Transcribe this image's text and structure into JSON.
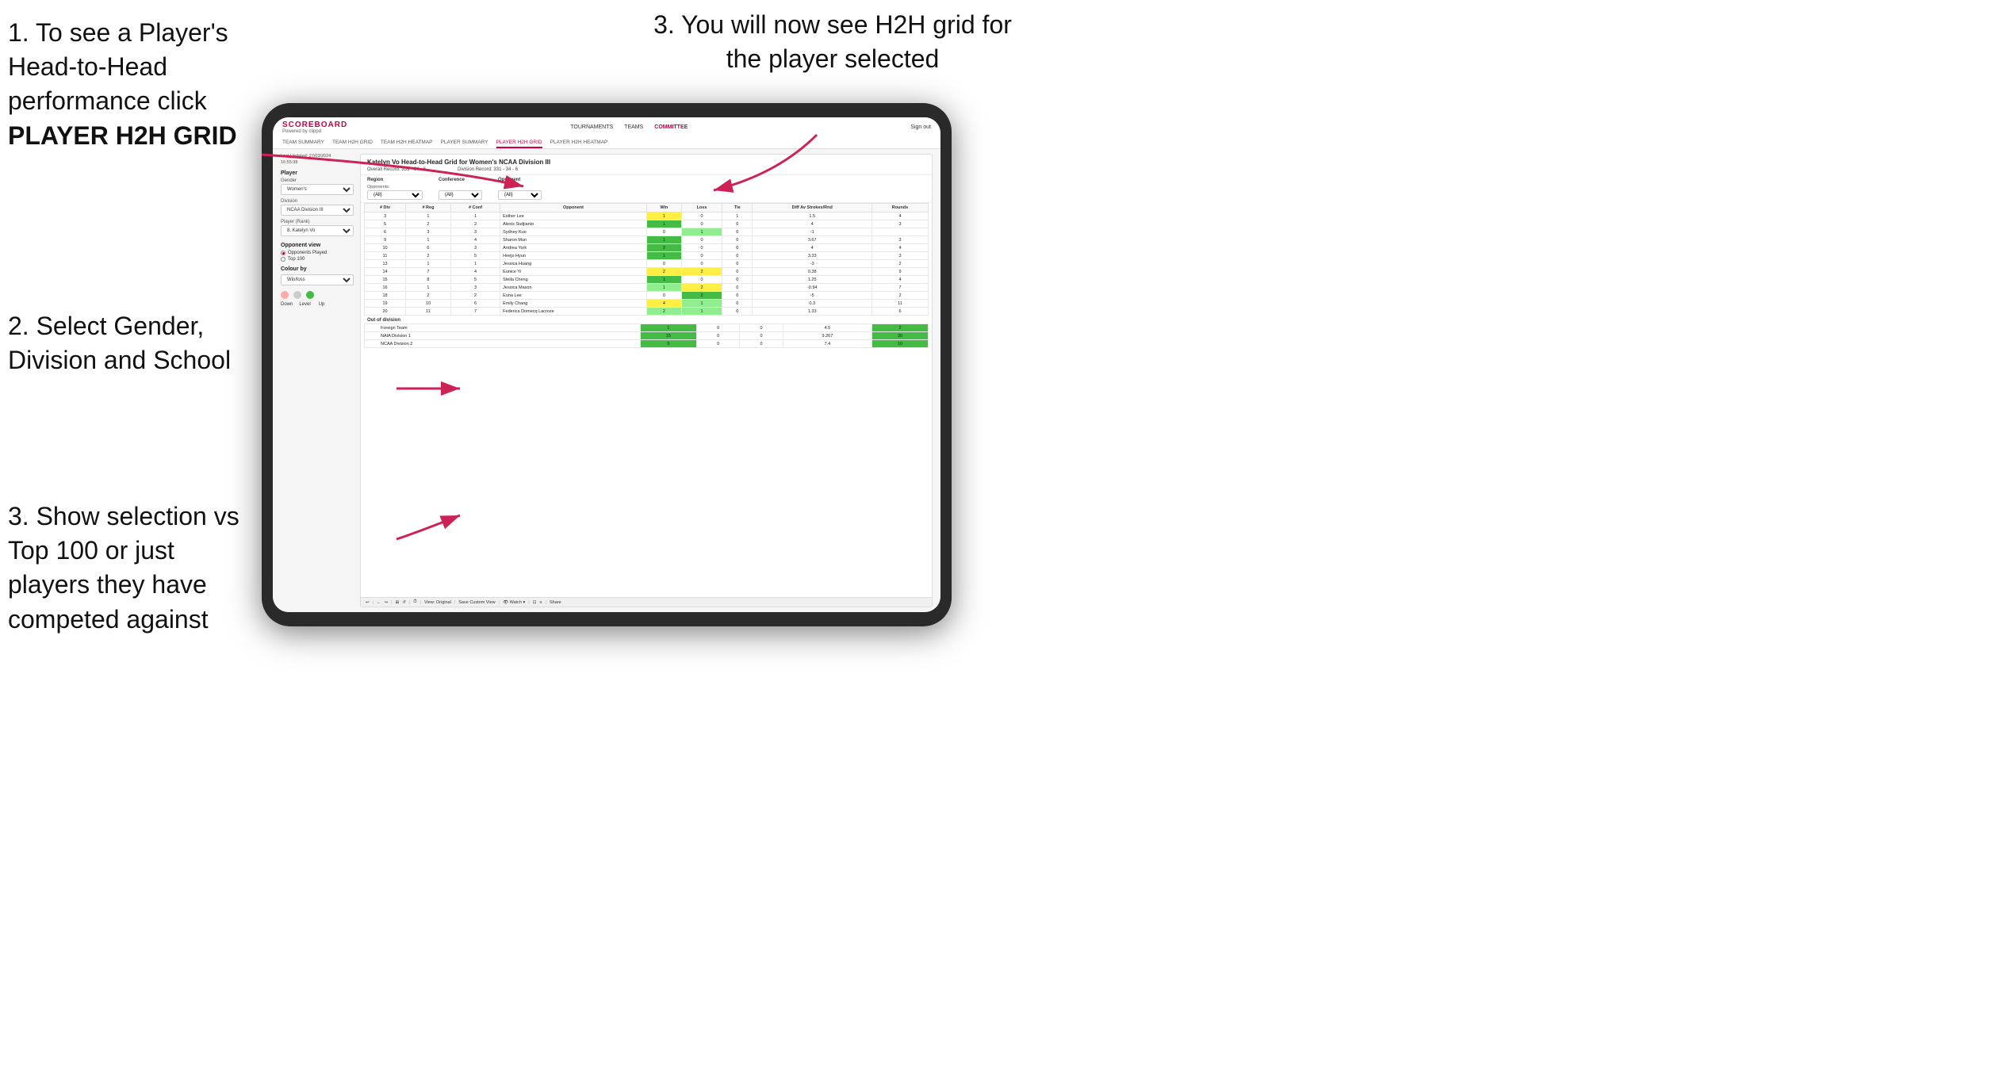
{
  "instructions": {
    "step1_title": "1. To see a Player's Head-to-Head performance click",
    "step1_bold": "PLAYER H2H GRID",
    "step2": "2. Select Gender, Division and School",
    "step3_top": "3. You will now see H2H grid for the player selected",
    "step3_bottom": "3. Show selection vs Top 100 or just players they have competed against"
  },
  "nav": {
    "logo": "SCOREBOARD",
    "logo_sub": "Powered by clippd",
    "links": [
      "TOURNAMENTS",
      "TEAMS",
      "COMMITTEE"
    ],
    "active_link": "COMMITTEE",
    "sign_out": "Sign out",
    "sub_links": [
      "TEAM SUMMARY",
      "TEAM H2H GRID",
      "TEAM H2H HEATMAP",
      "PLAYER SUMMARY",
      "PLAYER H2H GRID",
      "PLAYER H2H HEATMAP"
    ],
    "active_sub": "PLAYER H2H GRID"
  },
  "left_panel": {
    "timestamp_label": "Last Updated: 27/03/2024",
    "timestamp_time": "16:55:38",
    "player_label": "Player",
    "gender_label": "Gender",
    "gender_value": "Women's",
    "division_label": "Division",
    "division_value": "NCAA Division III",
    "player_rank_label": "Player (Rank)",
    "player_rank_value": "8. Katelyn Vo",
    "opponent_view_label": "Opponent view",
    "opponent_opts": [
      "Opponents Played",
      "Top 100"
    ],
    "selected_opponent_opt": "Opponents Played",
    "colour_by_label": "Colour by",
    "colour_by_value": "Win/loss",
    "colour_down": "Down",
    "colour_level": "Level",
    "colour_up": "Up"
  },
  "grid": {
    "title": "Katelyn Vo Head-to-Head Grid for Women's NCAA Division III",
    "overall_record": "Overall Record: 353 - 34 - 6",
    "division_record": "Division Record: 331 - 34 - 6",
    "region_label": "Region",
    "conference_label": "Conference",
    "opponent_label": "Opponent",
    "opponents_label": "Opponents:",
    "filter_all": "(All)",
    "columns": [
      "# Div",
      "# Reg",
      "# Conf",
      "Opponent",
      "Win",
      "Loss",
      "Tie",
      "Diff Av Strokes/Rnd",
      "Rounds"
    ],
    "rows": [
      {
        "div": 3,
        "reg": 1,
        "conf": 1,
        "opponent": "Esther Lee",
        "win": 1,
        "loss": 0,
        "tie": 1,
        "diff": 1.5,
        "rounds": 4,
        "win_color": "yellow",
        "loss_color": "",
        "tie_color": "yellow"
      },
      {
        "div": 5,
        "reg": 2,
        "conf": 2,
        "opponent": "Alexis Sudjianto",
        "win": 1,
        "loss": 0,
        "tie": 0,
        "diff": 4.0,
        "rounds": 3,
        "win_color": "green",
        "loss_color": "",
        "tie_color": ""
      },
      {
        "div": 6,
        "reg": 3,
        "conf": 3,
        "opponent": "Sydney Kuo",
        "win": 0,
        "loss": 1,
        "tie": 0,
        "diff": -1.0,
        "rounds": "",
        "win_color": "",
        "loss_color": "light-green",
        "tie_color": ""
      },
      {
        "div": 9,
        "reg": 1,
        "conf": 4,
        "opponent": "Sharon Mun",
        "win": 1,
        "loss": 0,
        "tie": 0,
        "diff": 3.67,
        "rounds": 3,
        "win_color": "green",
        "loss_color": "",
        "tie_color": ""
      },
      {
        "div": 10,
        "reg": 6,
        "conf": 3,
        "opponent": "Andrea York",
        "win": 2,
        "loss": 0,
        "tie": 0,
        "diff": 4.0,
        "rounds": 4,
        "win_color": "green",
        "loss_color": "",
        "tie_color": ""
      },
      {
        "div": 11,
        "reg": 2,
        "conf": 5,
        "opponent": "Heejo Hyun",
        "win": 1,
        "loss": 0,
        "tie": 0,
        "diff": 3.33,
        "rounds": 3,
        "win_color": "green",
        "loss_color": "",
        "tie_color": ""
      },
      {
        "div": 13,
        "reg": 1,
        "conf": 1,
        "opponent": "Jessica Huang",
        "win": 0,
        "loss": 0,
        "tie": 0,
        "diff": -3.0,
        "rounds": 2,
        "win_color": "",
        "loss_color": "",
        "tie_color": ""
      },
      {
        "div": 14,
        "reg": 7,
        "conf": 4,
        "opponent": "Eunice Yi",
        "win": 2,
        "loss": 2,
        "tie": 0,
        "diff": 0.38,
        "rounds": 9,
        "win_color": "yellow",
        "loss_color": "yellow",
        "tie_color": ""
      },
      {
        "div": 15,
        "reg": 8,
        "conf": 5,
        "opponent": "Stella Cheng",
        "win": 1,
        "loss": 0,
        "tie": 0,
        "diff": 1.25,
        "rounds": 4,
        "win_color": "green",
        "loss_color": "",
        "tie_color": ""
      },
      {
        "div": 16,
        "reg": 1,
        "conf": 3,
        "opponent": "Jessica Mason",
        "win": 1,
        "loss": 2,
        "tie": 0,
        "diff": -0.94,
        "rounds": 7,
        "win_color": "light-green",
        "loss_color": "yellow",
        "tie_color": ""
      },
      {
        "div": 18,
        "reg": 2,
        "conf": 2,
        "opponent": "Euna Lee",
        "win": 0,
        "loss": 2,
        "tie": 0,
        "diff": -5.0,
        "rounds": 2,
        "win_color": "",
        "loss_color": "green",
        "tie_color": ""
      },
      {
        "div": 19,
        "reg": 10,
        "conf": 6,
        "opponent": "Emily Chang",
        "win": 4,
        "loss": 1,
        "tie": 0,
        "diff": 0.3,
        "rounds": 11,
        "win_color": "yellow",
        "loss_color": "light-green",
        "tie_color": ""
      },
      {
        "div": 20,
        "reg": 11,
        "conf": 7,
        "opponent": "Federica Domecq Lacroze",
        "win": 2,
        "loss": 1,
        "tie": 0,
        "diff": 1.33,
        "rounds": 6,
        "win_color": "light-green",
        "loss_color": "light-green",
        "tie_color": ""
      }
    ],
    "out_of_division_label": "Out of division",
    "out_of_division_rows": [
      {
        "opponent": "Foreign Team",
        "win": 1,
        "loss": 0,
        "tie": 0,
        "diff": 4.5,
        "rounds": 2
      },
      {
        "opponent": "NAIA Division 1",
        "win": 15,
        "loss": 0,
        "tie": 0,
        "diff": 9.267,
        "rounds": 30
      },
      {
        "opponent": "NCAA Division 2",
        "win": 5,
        "loss": 0,
        "tie": 0,
        "diff": 7.4,
        "rounds": 10
      }
    ]
  },
  "toolbar": {
    "buttons": [
      "↩",
      "←",
      "↪",
      "⊞",
      "↺",
      "·",
      "⏱",
      "View: Original",
      "Save Custom View",
      "👁 Watch ▾",
      "⊡",
      "≡≡",
      "Share"
    ]
  }
}
